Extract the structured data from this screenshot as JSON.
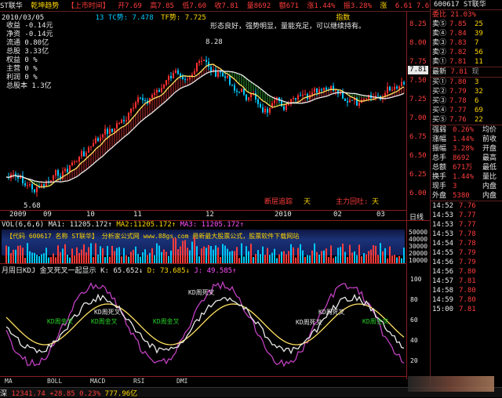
{
  "header": {
    "stock": "ST联华",
    "indicator": "乾坤趋势",
    "market_tag": "【上市时间】",
    "open": "开7.69",
    "high": "高7.85",
    "low": "低7.60",
    "close": "收7.81",
    "volume": "量8692",
    "amount": "额671",
    "change": "涨1.44%",
    "amplitude": "振3.28%",
    "right_tag": "涨",
    "tail": "6.61 7.6910.25%",
    "date": "2010/03/05",
    "tc": "13 TC势: 7.478",
    "tf": "TF势: 7.725",
    "index_label": "指数"
  },
  "info_panel": {
    "items": [
      "收益 -0.14元",
      "净资 -0.14元",
      "流通 0.80亿",
      "总股 3.33亿",
      "权益 0 %",
      "主营 0 %",
      "利润 0 %",
      "总股本 1.3亿"
    ]
  },
  "annotations": {
    "comment": "形态良好，强势明显，量能充足，可以继续持有。",
    "high_label": "8.28",
    "low_label": "5.68",
    "break_label": "断层追踪",
    "break_val": "天",
    "main_label": "主力回吐:",
    "main_val": "天",
    "kd1": "KD周死叉",
    "kd2": "KD周死叉",
    "kd3": "KD周金叉",
    "kd4": "KD周死叉",
    "kd5": "KD周金叉",
    "kd6": "KD周死叉",
    "kd7": "KD周金叉",
    "kd8": "KD周金叉"
  },
  "price_axis": [
    "8.25",
    "8.00",
    "7.75",
    "7.50",
    "7.25",
    "7.00",
    "6.75",
    "6.50",
    "6.25",
    "6.00"
  ],
  "price_tag": "7.81",
  "x_axis": [
    "2009",
    "09",
    "10",
    "11",
    "12",
    "2010",
    "02",
    "03"
  ],
  "volume_panel": {
    "header": "VOL(6,6,6)",
    "ma1": "MA1: 11205.172↑",
    "ma2": "MA2:11205.172↑",
    "ma3": "MA3: 11205.172↑",
    "axis_title": "日线",
    "axis": [
      "50000",
      "40000",
      "30000",
      "20000",
      "10000"
    ],
    "banner": "【代码 600617 名称 ST联华】   分析家公式网 www.88gs.com 最新最大股票公式，股票软件下载网站"
  },
  "kdj_panel": {
    "header": "月周日KDJ 金叉死叉一起显示",
    "k": "K: 65.652↓",
    "d": "D: 73.685↓",
    "j": "J: 49.585↑",
    "axis": [
      "100",
      "80",
      "60",
      "40",
      "20"
    ]
  },
  "bottom_tabs": [
    "MA",
    "BOLL",
    "MACD",
    "RSI",
    "DMI"
  ],
  "status_bar": {
    "market": "深",
    "index": "12341.74",
    "change": "+28.85",
    "pct": "0.23%",
    "amount": "777.96亿"
  },
  "right_panel": {
    "code": "600617 ST联华",
    "wei_bi": "委比 21.03%",
    "sells": [
      {
        "label": "卖⑤",
        "price": "7.85",
        "vol": "25"
      },
      {
        "label": "卖④",
        "price": "7.84",
        "vol": "39"
      },
      {
        "label": "卖③",
        "price": "7.83",
        "vol": "7"
      },
      {
        "label": "卖②",
        "price": "7.82",
        "vol": "56"
      },
      {
        "label": "卖①",
        "price": "7.81",
        "vol": "11"
      }
    ],
    "latest": {
      "label": "最新",
      "price": "7.81",
      "extra": "现"
    },
    "buys": [
      {
        "label": "买①",
        "price": "7.80",
        "vol": "3"
      },
      {
        "label": "买②",
        "price": "7.79",
        "vol": "32"
      },
      {
        "label": "买③",
        "price": "7.78",
        "vol": "6"
      },
      {
        "label": "买④",
        "price": "7.77",
        "vol": "69"
      },
      {
        "label": "买⑤",
        "price": "7.76",
        "vol": "22"
      }
    ],
    "stats": [
      {
        "k": "强弱",
        "v": "0.26%",
        "k2": "均价"
      },
      {
        "k": "涨幅",
        "v": "1.44%",
        "k2": "前收"
      },
      {
        "k": "振幅",
        "v": "3.28%",
        "k2": "开盘"
      },
      {
        "k": "总手",
        "v": "8692",
        "k2": "最高"
      },
      {
        "k": "总额",
        "v": "671万",
        "k2": "最低"
      },
      {
        "k": "换手",
        "v": "1.44%",
        "k2": "量比"
      },
      {
        "k": "现手",
        "v": "3",
        "k2": "内盘"
      },
      {
        "k": "外盘",
        "v": "5380",
        "k2": "内盘"
      }
    ],
    "ticks": [
      {
        "t": "14:52",
        "p": "7.76"
      },
      {
        "t": "14:53",
        "p": "7.77"
      },
      {
        "t": "14:53",
        "p": "7.77"
      },
      {
        "t": "14:53",
        "p": "7.78"
      },
      {
        "t": "14:54",
        "p": "7.78"
      },
      {
        "t": "14:55",
        "p": "7.79"
      },
      {
        "t": "14:56",
        "p": "7.79"
      },
      {
        "t": "14:56",
        "p": "7.80"
      },
      {
        "t": "14:57",
        "p": "7.81"
      },
      {
        "t": "14:58",
        "p": "7.80"
      },
      {
        "t": "14:59",
        "p": "7.80"
      },
      {
        "t": "15:00",
        "p": "7.81"
      }
    ]
  }
}
